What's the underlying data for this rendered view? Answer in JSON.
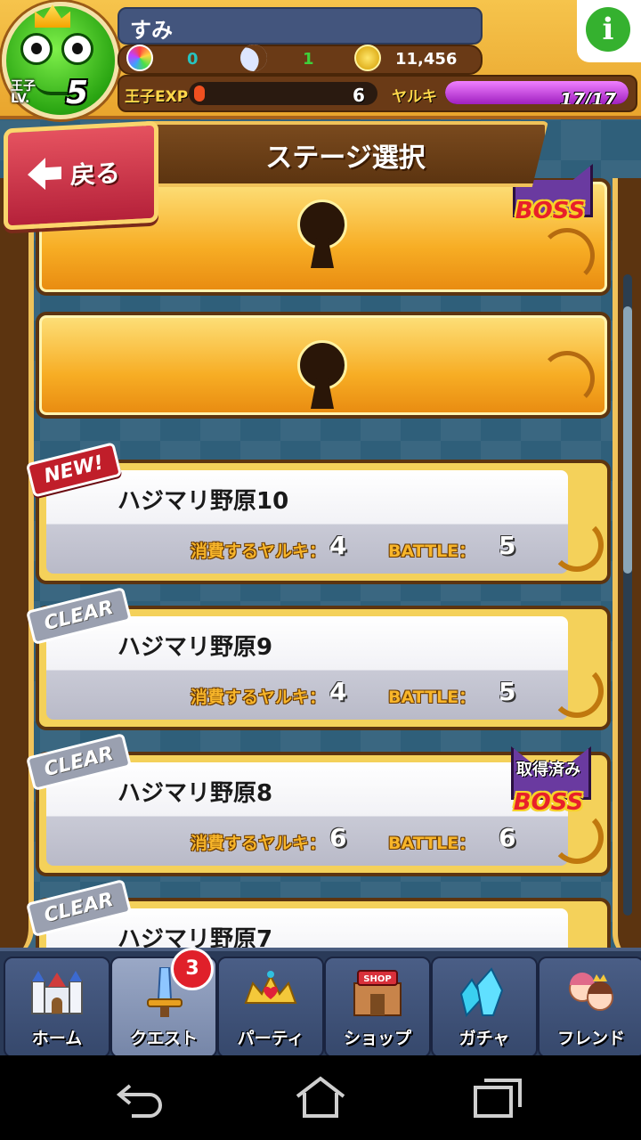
{
  "header": {
    "player_name": "すみ",
    "level_label": "王子\nLV.",
    "level_value": "5",
    "resources": {
      "rainbow_gems": "0",
      "moons": "1",
      "coins": "11,456"
    },
    "exp_label": "王子EXP",
    "exp_value": "6",
    "yaruki_label": "ヤルキ",
    "yaruki_value": "17/17",
    "yaruki_fraction": 1.0
  },
  "title": "ステージ選択",
  "back_label": "戻る",
  "stages": [
    {
      "name": "ハジマリ野原10",
      "tag": "NEW!",
      "cost_label": "消費するヤルキ：",
      "cost": "4",
      "battle_label": "BATTLE：",
      "battle": "5"
    },
    {
      "name": "ハジマリ野原9",
      "tag": "CLEAR",
      "cost_label": "消費するヤルキ：",
      "cost": "4",
      "battle_label": "BATTLE：",
      "battle": "5"
    },
    {
      "name": "ハジマリ野原8",
      "tag": "CLEAR",
      "cost_label": "消費するヤルキ：",
      "cost": "6",
      "battle_label": "BATTLE：",
      "battle": "6",
      "boss_text": "取得済み",
      "boss_word": "BOSS"
    },
    {
      "name": "ハジマリ野原7",
      "tag": "CLEAR"
    }
  ],
  "locked_boss_word": "BOSS",
  "nav": [
    {
      "label": "ホーム",
      "icon": "castle-icon"
    },
    {
      "label": "クエスト",
      "icon": "sword-icon",
      "badge": "3"
    },
    {
      "label": "パーティ",
      "icon": "tiara-icon"
    },
    {
      "label": "ショップ",
      "icon": "shop-icon",
      "sign": "SHOP"
    },
    {
      "label": "ガチャ",
      "icon": "crystal-icon"
    },
    {
      "label": "フレンド",
      "icon": "friends-icon"
    }
  ],
  "colors": {
    "accent_gold": "#f0c25a",
    "brown": "#5c3410",
    "yaruki_purple": "#a020c0"
  }
}
